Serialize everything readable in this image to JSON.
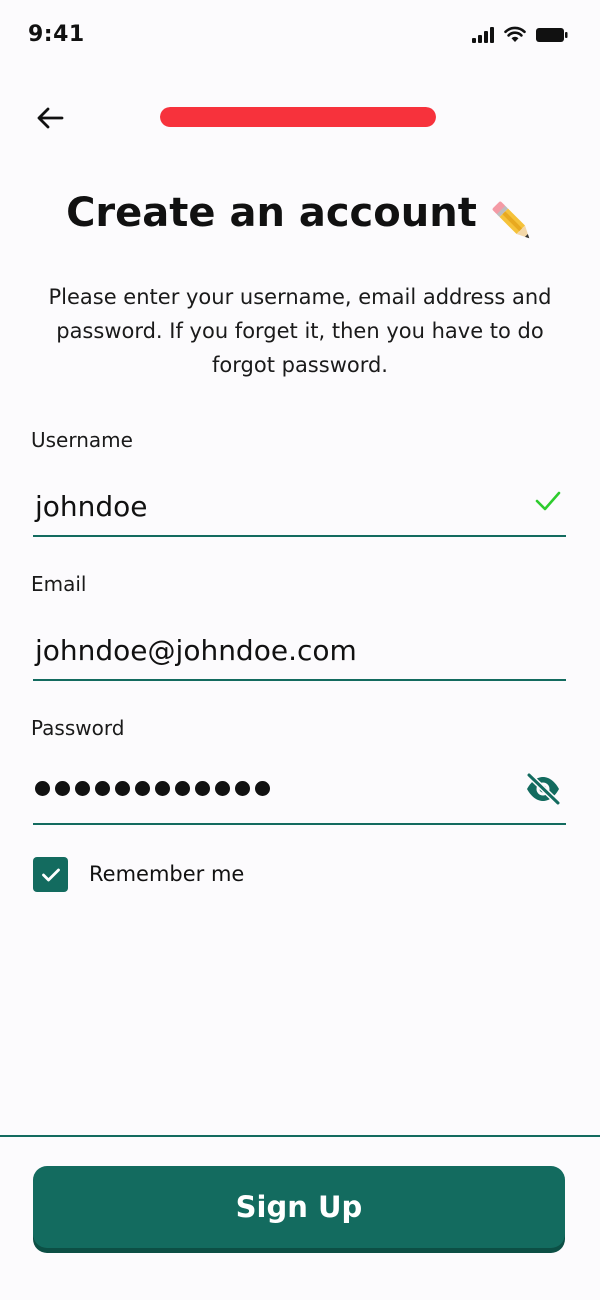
{
  "status_bar": {
    "time": "9:41"
  },
  "header": {
    "back_icon": "arrow-left-icon",
    "progress_fraction": 1.0
  },
  "title": {
    "text": "Create an account",
    "emoji_icon": "pencil-icon"
  },
  "subtitle": "Please enter your username, email address and password. If you forget it, then you have to do forgot password.",
  "form": {
    "username": {
      "label": "Username",
      "value": "johndoe",
      "valid_icon": "checkmark-icon"
    },
    "email": {
      "label": "Email",
      "value": "johndoe@johndoe.com"
    },
    "password": {
      "label": "Password",
      "masked_length": 12,
      "toggle_icon": "eye-off-icon"
    },
    "remember": {
      "label": "Remember me",
      "checked": true
    }
  },
  "footer": {
    "signup_label": "Sign Up"
  },
  "colors": {
    "primary": "#136b5f",
    "progress": "#f7323c",
    "valid": "#2ecc2e",
    "background": "#fcfbfd"
  }
}
